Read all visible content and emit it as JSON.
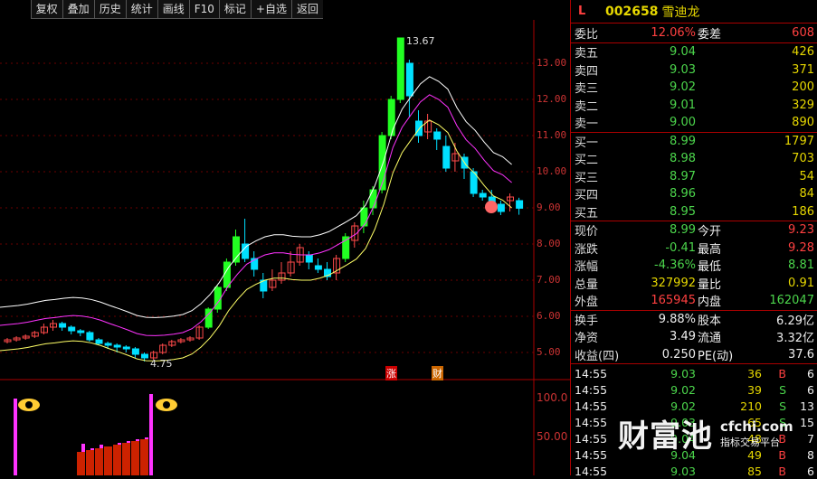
{
  "toolbar": {
    "buttons": [
      "复权",
      "叠加",
      "历史",
      "统计",
      "画线",
      "F10",
      "标记",
      "+自选",
      "返回"
    ]
  },
  "chart": {
    "y_axis_ticks": [
      "13.00",
      "12.00",
      "11.00",
      "10.00",
      "9.00",
      "8.00",
      "7.00",
      "6.00",
      "5.00"
    ],
    "max_label": "13.67",
    "min_label": "4.75",
    "volume_axis_ticks": [
      "100.0",
      "50.00"
    ],
    "markers": {
      "zhang": "涨",
      "caibao": "财"
    },
    "colors": {
      "up": "#ff4a4a",
      "down": "#00e0ff",
      "limit_up": "#22ff22",
      "ma_white": "#ffffff",
      "ma_magenta": "#ff33ff",
      "ma_yellow": "#ffff66"
    }
  },
  "quote": {
    "flag": "L",
    "code": "002658",
    "name": "雪迪龙",
    "weibi_label": "委比",
    "weibi": "12.06%",
    "weicha_label": "委差",
    "weicha": "608",
    "asks": [
      {
        "label": "卖五",
        "price": "9.04",
        "vol": "426"
      },
      {
        "label": "卖四",
        "price": "9.03",
        "vol": "371"
      },
      {
        "label": "卖三",
        "price": "9.02",
        "vol": "200"
      },
      {
        "label": "卖二",
        "price": "9.01",
        "vol": "329"
      },
      {
        "label": "卖一",
        "price": "9.00",
        "vol": "890"
      }
    ],
    "bids": [
      {
        "label": "买一",
        "price": "8.99",
        "vol": "1797"
      },
      {
        "label": "买二",
        "price": "8.98",
        "vol": "703"
      },
      {
        "label": "买三",
        "price": "8.97",
        "vol": "54"
      },
      {
        "label": "买四",
        "price": "8.96",
        "vol": "84"
      },
      {
        "label": "买五",
        "price": "8.95",
        "vol": "186"
      }
    ],
    "stats": [
      {
        "l1": "现价",
        "v1": "8.99",
        "c1": "green",
        "l2": "今开",
        "v2": "9.23",
        "c2": "red"
      },
      {
        "l1": "涨跌",
        "v1": "-0.41",
        "c1": "green",
        "l2": "最高",
        "v2": "9.28",
        "c2": "red"
      },
      {
        "l1": "涨幅",
        "v1": "-4.36%",
        "c1": "green",
        "l2": "最低",
        "v2": "8.81",
        "c2": "green"
      },
      {
        "l1": "总量",
        "v1": "327992",
        "c1": "yellow",
        "l2": "量比",
        "v2": "0.91",
        "c2": "yellow"
      },
      {
        "l1": "外盘",
        "v1": "165945",
        "c1": "red",
        "l2": "内盘",
        "v2": "162047",
        "c2": "green"
      }
    ],
    "stats2": [
      {
        "l1": "换手",
        "v1": "9.88%",
        "l2": "股本",
        "v2": "6.29亿"
      },
      {
        "l1": "净资",
        "v1": "3.49",
        "l2": "流通",
        "v2": "3.32亿"
      },
      {
        "l1": "收益(四)",
        "v1": "0.250",
        "l2": "PE(动)",
        "v2": "37.6"
      }
    ],
    "ticks": [
      {
        "time": "14:55",
        "price": "9.03",
        "vol": "36",
        "side": "B",
        "n": "6"
      },
      {
        "time": "14:55",
        "price": "9.02",
        "vol": "39",
        "side": "S",
        "n": "6"
      },
      {
        "time": "14:55",
        "price": "9.02",
        "vol": "210",
        "side": "S",
        "n": "13"
      },
      {
        "time": "14:55",
        "price": "9.03",
        "vol": "65",
        "side": "S",
        "n": "15"
      },
      {
        "time": "14:55",
        "price": "9.04",
        "vol": "48",
        "side": "B",
        "n": "7"
      },
      {
        "time": "14:55",
        "price": "9.04",
        "vol": "49",
        "side": "B",
        "n": "8"
      },
      {
        "time": "14:55",
        "price": "9.03",
        "vol": "85",
        "side": "B",
        "n": "6"
      }
    ]
  },
  "watermark": {
    "big": "财富池",
    "url": "cfchi.com",
    "tag": "指标交易平台"
  }
}
